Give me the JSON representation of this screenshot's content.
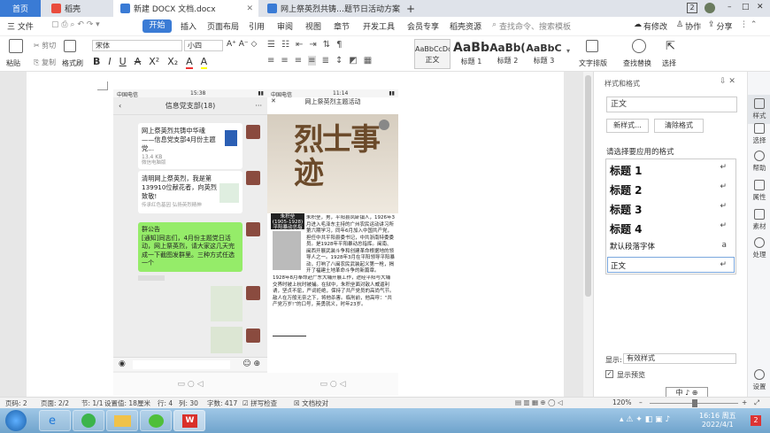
{
  "tabs": [
    {
      "label": "首页"
    },
    {
      "label": "稻壳"
    },
    {
      "label": "新建 DOCX 文档.docx"
    },
    {
      "label": "网上祭英烈共铸…题节日活动方案"
    }
  ],
  "tab_new_label": "+",
  "window": {
    "badge": "2",
    "minimize": "–",
    "maximize": "□",
    "close": "✕"
  },
  "menu": {
    "file": "三 文件",
    "items": [
      "开始",
      "插入",
      "页面布局",
      "引用",
      "审阅",
      "视图",
      "章节",
      "开发工具",
      "会员专享",
      "稻壳资源"
    ],
    "search_placeholder": "查找命令、搜索模板",
    "modified": "有修改",
    "collab": "协作",
    "share": "分享"
  },
  "ribbon": {
    "paste": "粘贴",
    "cut": "剪切",
    "copy": "复制",
    "format_painter": "格式刷",
    "font_name": "宋体",
    "font_size": "小四",
    "styles": [
      {
        "preview": "AaBbCcDd",
        "caption": "正文"
      },
      {
        "preview": "AaBb",
        "caption": "标题 1"
      },
      {
        "preview": "AaBb(",
        "caption": "标题 2"
      },
      {
        "preview": "AaBbC",
        "caption": "标题 3"
      }
    ],
    "text_layout": "文字排版",
    "find_replace": "查找替换",
    "select": "选择"
  },
  "wechat": {
    "status_left": "中国电信",
    "status_time": "15:38",
    "title": "信息党支部(18)",
    "file_msg": {
      "title": "网上祭英烈共铸中华魂——信息党支部4月份主题党...",
      "size": "13.4 KB",
      "source": "微信电脑版"
    },
    "msg2": "清明网上祭英烈，我是第139910位献花者，向英烈致敬!",
    "msg2_sub": "传承红色基因 弘扬英烈精神",
    "announcement": "群公告\n[通知]同志们，4月份主题党日活动，网上祭英烈，请大家这几天完成一下截图发群里。三种方式任选一个"
  },
  "article": {
    "status_left": "中国电信",
    "status_time": "11:14",
    "title": "网上祭英烈主题活动",
    "headline": "烈士事迹",
    "person_name": "朱积垒",
    "person_years": "(1905-1928)",
    "person_caption": "平阳暴动总指挥",
    "para1": "朱积垒，男，平阳县凤卧镇人，1926年3月进入毛泽东主持的广州农民运动讲习所第六期学习，同年6月加入中国共产党，担任中共平阳县委书记，中共浙南特委委员。是1928年平阳暴动总指挥。闽南、闽西开展武装斗争和创建革命根据地的领导人之一。1928年3月在平阳领导平阳暴动，打响了八闽农民武装起义第一枪，揭开了福建土地革命斗争的新篇章。",
    "para2": "1928年8月奉命赴广东大埔开展工作，途经平阳与大埔交界时被上杭时被捕。在狱中，朱积垒面对敌人威逼利诱，坚贞不屈，严词拒绝，保持了共产党员的高尚气节。敌人在万般无奈之下，将他杀害。临刑前，他高呼：“共产党万岁!”的口号，英勇就义，时年23岁。"
  },
  "panel": {
    "header": "样式和格式",
    "current_style": "正文",
    "new_style": "新样式...",
    "clear_format": "清除格式",
    "apply_label": "请选择要应用的格式",
    "items": [
      "标题 1",
      "标题 2",
      "标题 3",
      "标题 4",
      "默认段落字体",
      "正文"
    ],
    "show_label": "显示:",
    "show_value": "有效样式",
    "preview_label": "显示预览",
    "ime": "中 ♪ ⊕"
  },
  "sidebar": [
    "样式",
    "选择",
    "帮助",
    "属性",
    "素材",
    "处理",
    "设置"
  ],
  "status": {
    "page": "页码: 2",
    "pages": "页面: 2/2",
    "section": "节: 1/1",
    "settings": "设置值: 18厘米",
    "row": "行: 4",
    "col": "列: 30",
    "words": "字数: 417",
    "spell": "拼写检查",
    "doc_check": "文档校对",
    "zoom": "120%"
  },
  "taskbar": {
    "time": "16:16 周五",
    "date": "2022/4/1",
    "badge": "2"
  },
  "colors": {
    "accent": "#3a7bd5",
    "wechat_green": "#95ec69",
    "taskbar": "#7fb0d6"
  }
}
